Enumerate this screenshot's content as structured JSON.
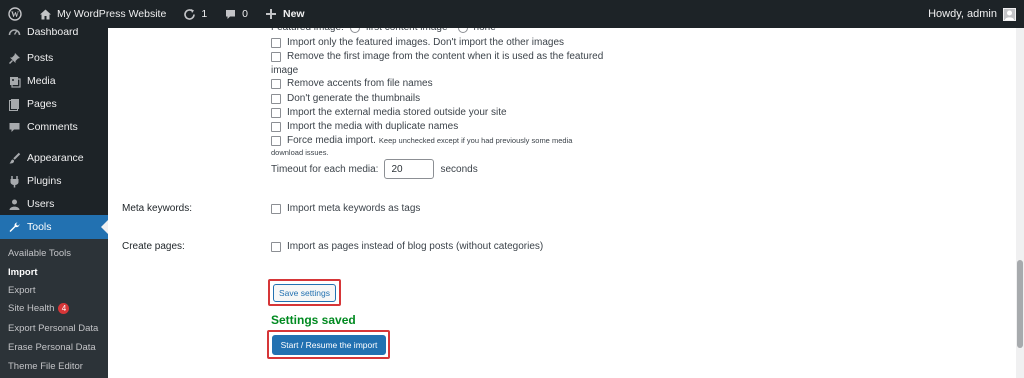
{
  "adminbar": {
    "site_name": "My WordPress Website",
    "updates_count": "1",
    "comments_count": "0",
    "new_label": "New",
    "howdy": "Howdy, admin"
  },
  "sidebar": {
    "dashboard": "Dashboard",
    "posts": "Posts",
    "media": "Media",
    "pages": "Pages",
    "comments": "Comments",
    "appearance": "Appearance",
    "plugins": "Plugins",
    "users": "Users",
    "tools": "Tools",
    "submenu": {
      "available_tools": "Available Tools",
      "import": "Import",
      "export": "Export",
      "site_health": "Site Health",
      "site_health_badge": "4",
      "export_personal": "Export Personal Data",
      "erase_personal": "Erase Personal Data",
      "theme_editor": "Theme File Editor"
    }
  },
  "settings": {
    "featured_image_label": "Featured image:",
    "featured_first": "first content image",
    "featured_none": "none",
    "import_only_featured": "Import only the featured images. Don't import the other images",
    "remove_first_line1": "Remove the first image from the content when it is used as the featured",
    "remove_first_line2": "image",
    "remove_accents": "Remove accents from file names",
    "dont_generate": "Don't generate the thumbnails",
    "import_external": "Import the external media stored outside your site",
    "import_duplicate": "Import the media with duplicate names",
    "force_media": "Force media import.",
    "force_note_line1": "Keep unchecked except if you had previously some media",
    "force_note_line2": "download issues.",
    "timeout_label": "Timeout for each media:",
    "timeout_value": "20",
    "seconds": "seconds",
    "meta_keywords_label": "Meta keywords:",
    "meta_keywords_option": "Import meta keywords as tags",
    "create_pages_label": "Create pages:",
    "create_pages_option": "Import as pages instead of blog posts (without categories)"
  },
  "actions": {
    "save_settings": "Save settings",
    "settings_saved": "Settings saved",
    "start_import": "Start / Resume the import"
  },
  "colors": {
    "admin_dark": "#1d2327",
    "accent": "#2271b1",
    "success": "#008a20",
    "highlight": "#d63638"
  }
}
